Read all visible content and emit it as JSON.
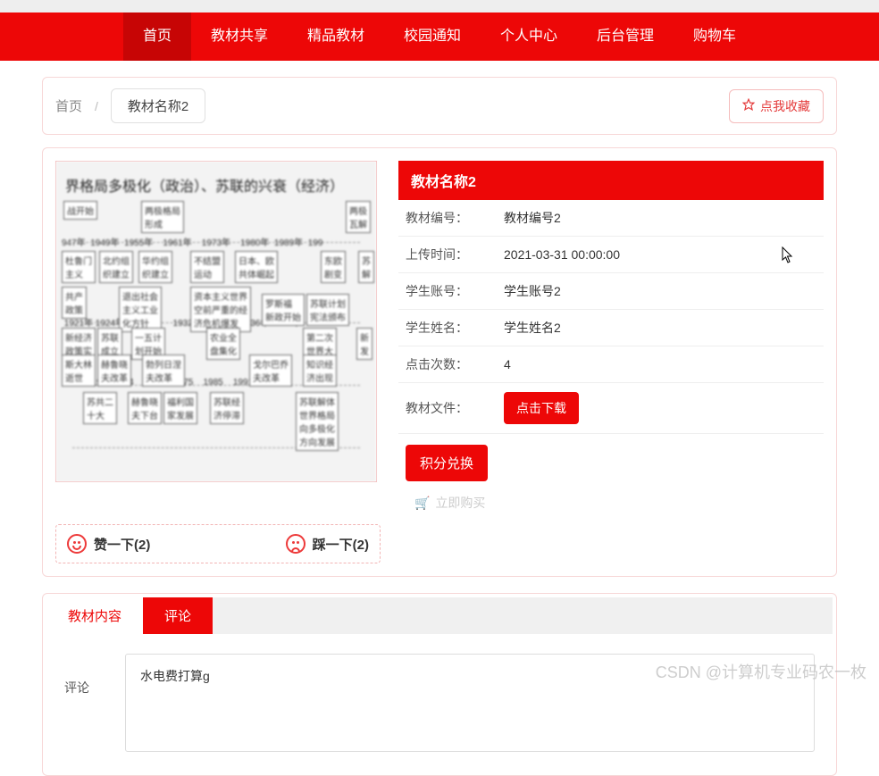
{
  "nav": {
    "items": [
      "首页",
      "教材共享",
      "精品教材",
      "校园通知",
      "个人中心",
      "后台管理",
      "购物车"
    ],
    "activeIndex": 0
  },
  "breadcrumb": {
    "home": "首页",
    "sep": "/",
    "current": "教材名称2"
  },
  "favorite": {
    "label": "点我收藏"
  },
  "detail": {
    "title": "教材名称2",
    "rows": [
      {
        "label": "教材编号：",
        "value": "教材编号2"
      },
      {
        "label": "上传时间：",
        "value": "2021-03-31 00:00:00"
      },
      {
        "label": "学生账号：",
        "value": "学生账号2"
      },
      {
        "label": "学生姓名：",
        "value": "学生姓名2"
      },
      {
        "label": "点击次数：",
        "value": "4"
      }
    ],
    "file_label": "教材文件：",
    "download_label": "点击下载",
    "points_label": "积分兑换",
    "disabled_note": "立即购买"
  },
  "vote": {
    "up_label": "赞一下(2)",
    "down_label": "踩一下(2)"
  },
  "tabs": {
    "items": [
      "教材内容",
      "评论"
    ]
  },
  "comment": {
    "label": "评论",
    "value": "水电费打算g"
  },
  "watermark": "CSDN @计算机专业码农一枚"
}
